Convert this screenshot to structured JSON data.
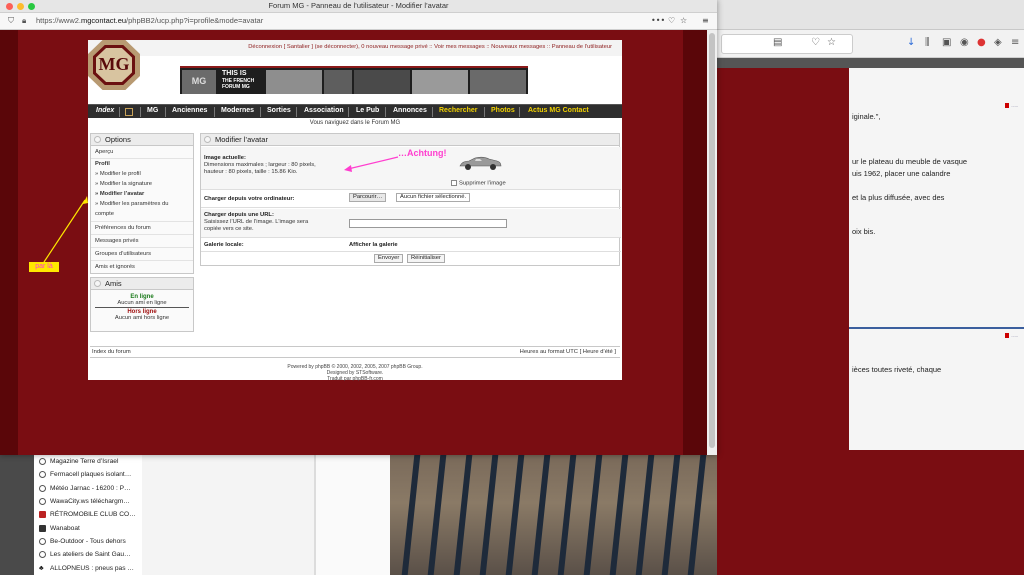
{
  "window": {
    "title": "Forum MG - Panneau de l’utilisateur - Modifier l’avatar",
    "url_prefix": "https://www2.",
    "url_domain": "mgcontact.eu",
    "url_path": "/phpBB2/ucp.php?i=profile&mode=avatar"
  },
  "header": {
    "userlinks": "Déconnexion [ Santalier ] (se déconnecter), 0 nouveau message privé :: Voir mes messages :: Nouveaux messages :: Panneau de l’utilisateur",
    "logo_text": "MG",
    "banner_mark": "MG",
    "banner_line1": "THIS IS",
    "banner_line2": "THE FRENCH",
    "banner_line3": "FORUM MG"
  },
  "menu": {
    "items": [
      "Index",
      "MG",
      "Anciennes",
      "Modernes",
      "Sorties",
      "Association",
      "Le Pub",
      "Annonces",
      "Rechercher",
      "Photos",
      "Actus MG Contact"
    ]
  },
  "nav_message": "Vous naviguez dans le Forum MG",
  "options_panel": {
    "title": "Options",
    "apercu": "Aperçu",
    "profil": "Profil",
    "modifier_profil": "» Modifier le profil",
    "modifier_signature": "» Modifier la signature",
    "modifier_avatar": "» Modifier l’avatar",
    "modifier_params_1": "» Modifier les paramètres du",
    "modifier_params_2": "compte",
    "preferences": "Préférences du forum",
    "messages_prives": "Messages privés",
    "groupes": "Groupes d’utilisateurs",
    "amis": "Amis et ignorés"
  },
  "friends_panel": {
    "title": "Amis",
    "online_head": "En ligne",
    "online_none": "Aucun ami en ligne",
    "offline_head": "Hors ligne",
    "offline_none": "Aucun ami hors ligne"
  },
  "avatar_panel": {
    "title": "Modifier l’avatar",
    "current_label": "Image actuelle:",
    "current_desc_1": "Dimensions maximales ; largeur : 80 pixels,",
    "current_desc_2": "hauteur : 80 pixels, taille : 15.86 Kio.",
    "delete_label": "Supprimer l’image",
    "upload_label": "Charger depuis votre ordinateur:",
    "browse_button": "Parcourir…",
    "no_file": "Aucun fichier sélectionné.",
    "url_label": "Charger depuis une URL:",
    "url_desc_1": "Saisissez l’URL de l’image. L’image sera",
    "url_desc_2": "copiée vers ce site.",
    "gallery_label": "Galerie locale:",
    "gallery_link": "Afficher la galerie",
    "submit": "Envoyer",
    "reset": "Réinitialiser"
  },
  "footer": {
    "index_link": "Index du forum",
    "timezone": "Heures au format UTC [ Heure d’été ]",
    "powered_1": "Powered by phpBB © 2000, 2002, 2005, 2007 phpBB Group.",
    "powered_2": "Designed by STSoftware.",
    "powered_3": "Traduit par phpBB-fr.com"
  },
  "annotations": {
    "achtung": "…Achtung!",
    "par_la": "par là",
    "color": "#ff3ecf"
  },
  "background_window": {
    "lines": [
      "iginale.\",",
      "ur le plateau du meuble de vasque",
      "uis 1962, placer une calandre",
      "et la plus diffusée, avec des",
      "oix bis.",
      "ièces toutes riveté, chaque"
    ]
  },
  "bookmarks": [
    "Magazine Terre d’Israel",
    "Fermacell plaques isolant…",
    "Météo Jarnac - 16200 : P…",
    "WawaCity.ws  téléchargm…",
    "RÉTROMOBILE CLUB CO…",
    "Wanaboat",
    "Be-Outdoor - Tous dehors",
    "Les ateliers de Saint Gau…",
    "ALLOPNEUS : pneus pas …"
  ]
}
